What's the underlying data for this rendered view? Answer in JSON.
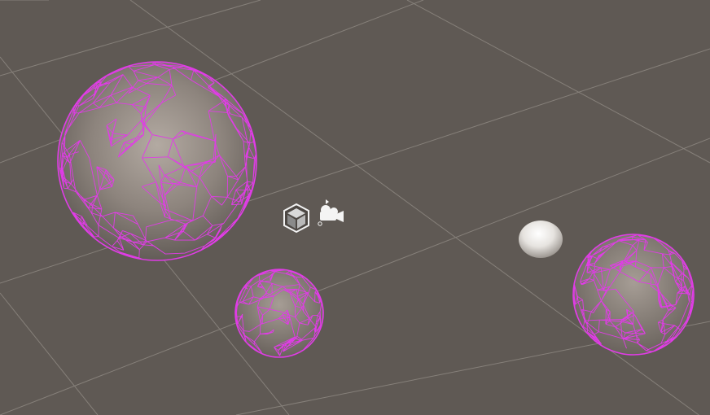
{
  "viewport": {
    "background_color": "#5f5954",
    "grid_color": "#86807a",
    "wireframe_color": "#e03ce6"
  },
  "objects": [
    {
      "name": "large-wireframe-sphere",
      "kind": "wireframe-sphere"
    },
    {
      "name": "small-wireframe-sphere",
      "kind": "wireframe-sphere"
    },
    {
      "name": "right-wireframe-sphere",
      "kind": "wireframe-sphere"
    },
    {
      "name": "solid-white-sphere",
      "kind": "shaded-sphere"
    }
  ],
  "gizmos": [
    {
      "name": "game-object-cube-icon",
      "icon": "cube-gizmo-icon"
    },
    {
      "name": "camera-gizmo-icon",
      "icon": "camera-icon"
    }
  ]
}
